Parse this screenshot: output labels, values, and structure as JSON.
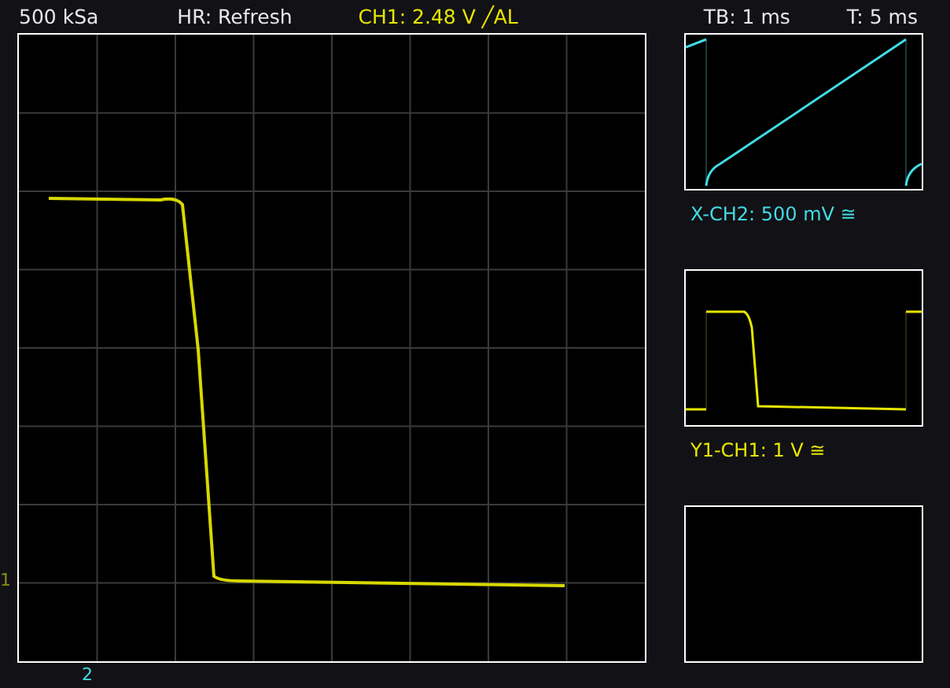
{
  "status_bar": {
    "sample_rate": "500 kSa",
    "mode": "HR: Refresh",
    "trigger": {
      "text": "CH1: 2.48 V ╱AL",
      "color": "#e6e600"
    },
    "timebase": "TB: 1 ms",
    "trigger_time": "T: 5 ms"
  },
  "main_display": {
    "level_marker": {
      "text": "1",
      "color": "#8c8c1e"
    },
    "trigger_marker": {
      "text": "2",
      "color": "#40dce6"
    }
  },
  "side_panels": [
    {
      "kind": "sawtooth",
      "color": "#40dce6",
      "label": "X-CH2: 500 mV ≅"
    },
    {
      "kind": "pulse",
      "color": "#e6e600",
      "label": "Y1-CH1: 1 V ≅"
    },
    {
      "kind": "empty"
    }
  ]
}
